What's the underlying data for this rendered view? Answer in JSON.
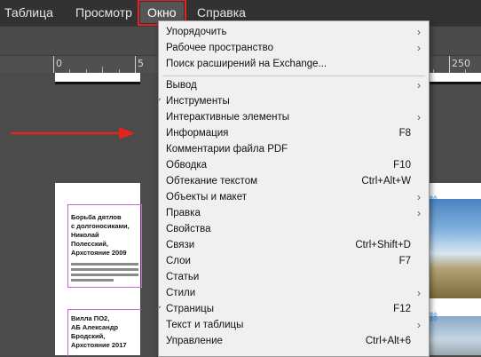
{
  "menubar": {
    "items": [
      "Таблица",
      "Просмотр",
      "Окно",
      "Справка"
    ],
    "active": "Окно"
  },
  "ruler": {
    "labels": [
      "0",
      "5",
      "250"
    ]
  },
  "document": {
    "block1": [
      "Борьба дятлов",
      "с долгоносиками,",
      "Николай",
      "Полесский,",
      "Архстояние 2009"
    ],
    "block2": [
      "Вилла ПО2,",
      "АБ Александр",
      "Бродский,",
      "Архстояние 2017"
    ]
  },
  "menu": {
    "group1": [
      {
        "label": "Упорядочить",
        "submenu": true
      },
      {
        "label": "Рабочее пространство",
        "submenu": true
      },
      {
        "label": "Поиск расширений на Exchange..."
      }
    ],
    "group2": [
      {
        "label": "Вывод",
        "submenu": true
      },
      {
        "label": "Инструменты",
        "checked": true
      },
      {
        "label": "Интерактивные элементы",
        "submenu": true
      },
      {
        "label": "Информация",
        "shortcut": "F8"
      },
      {
        "label": "Комментарии файла PDF"
      },
      {
        "label": "Обводка",
        "shortcut": "F10"
      },
      {
        "label": "Обтекание текстом",
        "shortcut": "Ctrl+Alt+W"
      },
      {
        "label": "Объекты и макет",
        "submenu": true
      },
      {
        "label": "Правка",
        "submenu": true
      },
      {
        "label": "Свойства"
      },
      {
        "label": "Связи",
        "shortcut": "Ctrl+Shift+D"
      },
      {
        "label": "Слои",
        "shortcut": "F7"
      },
      {
        "label": "Статьи"
      },
      {
        "label": "Стили",
        "submenu": true
      },
      {
        "label": "Страницы",
        "shortcut": "F12",
        "checked": true
      },
      {
        "label": "Текст и таблицы",
        "submenu": true
      },
      {
        "label": "Управление",
        "shortcut": "Ctrl+Alt+6"
      }
    ]
  },
  "colors": {
    "highlight_border": "#e2241f",
    "arrow": "#e2241f",
    "check": "#3a8fe0"
  }
}
